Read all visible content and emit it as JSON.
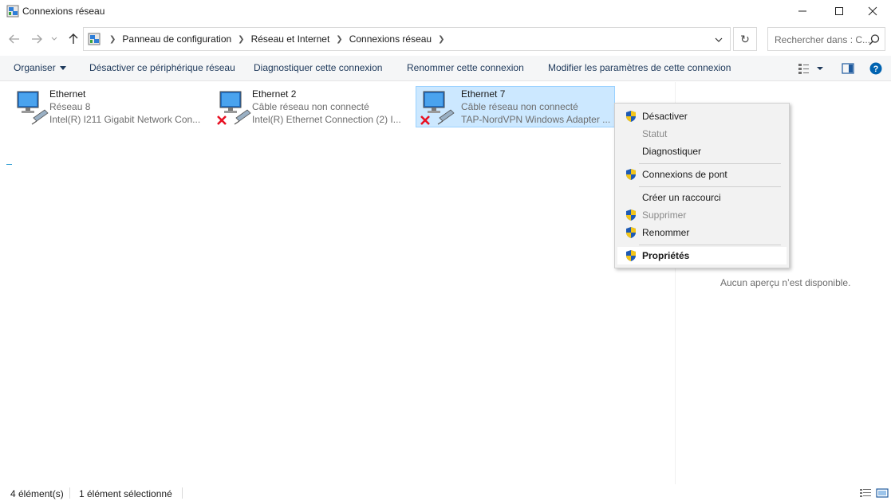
{
  "window": {
    "title": "Connexions réseau",
    "title_icon": "network-connections-icon"
  },
  "nav": {
    "breadcrumbs": [
      "Panneau de configuration",
      "Réseau et Internet",
      "Connexions réseau"
    ],
    "search_placeholder": "Rechercher dans : C..."
  },
  "toolbar": {
    "organize": "Organiser",
    "disable": "Désactiver ce périphérique réseau",
    "diagnose": "Diagnostiquer cette connexion",
    "rename": "Renommer cette connexion",
    "change_settings": "Modifier les paramètres de cette connexion"
  },
  "connections": [
    {
      "name": "Ethernet",
      "status": "Réseau 8",
      "device": "Intel(R) I211 Gigabit Network Con...",
      "disconnected": false,
      "selected": false
    },
    {
      "name": "Ethernet 2",
      "status": "Câble réseau non connecté",
      "device": "Intel(R) Ethernet Connection (2) I...",
      "disconnected": true,
      "selected": false
    },
    {
      "name": "Ethernet 7",
      "status": "Câble réseau non connecté",
      "device": "TAP-NordVPN Windows Adapter ...",
      "disconnected": true,
      "selected": true
    }
  ],
  "context_menu": [
    {
      "label": "Désactiver",
      "shield": true,
      "enabled": true
    },
    {
      "label": "Statut",
      "shield": false,
      "enabled": false
    },
    {
      "label": "Diagnostiquer",
      "shield": false,
      "enabled": true
    },
    {
      "label": "Connexions de pont",
      "shield": true,
      "enabled": true
    },
    {
      "label": "Créer un raccourci",
      "shield": false,
      "enabled": true
    },
    {
      "label": "Supprimer",
      "shield": true,
      "enabled": false
    },
    {
      "label": "Renommer",
      "shield": true,
      "enabled": true
    },
    {
      "label": "Propriétés",
      "shield": true,
      "enabled": true,
      "default": true
    }
  ],
  "preview": {
    "text": "Aucun aperçu n’est disponible."
  },
  "status": {
    "item_count": "4 élément(s)",
    "selected_count": "1 élément sélectionné"
  },
  "colors": {
    "selection_bg": "#cce8ff",
    "selection_border": "#99d1ff",
    "toolbar_text": "#1e395b",
    "error_x": "#e81123",
    "help_blue": "#0063b1"
  }
}
